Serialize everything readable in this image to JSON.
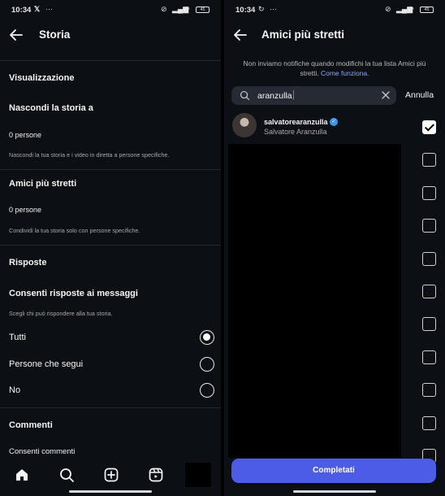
{
  "status_bar": {
    "time": "10:34",
    "battery": "45"
  },
  "left": {
    "title": "Storia",
    "visualization_label": "Visualizzazione",
    "hide_story": {
      "title": "Nascondi la storia a",
      "value": "0 persone",
      "description": "Nascondi la tua storia e i video in diretta a persone specifiche."
    },
    "close_friends": {
      "title": "Amici più stretti",
      "value": "0 persone",
      "description": "Condividi la tua storia solo con persone specifiche."
    },
    "replies_label": "Risposte",
    "allow_replies": {
      "title": "Consenti risposte ai messaggi",
      "description": "Scegli chi può rispondere alla tua storia.",
      "options": [
        {
          "label": "Tutti",
          "selected": true
        },
        {
          "label": "Persone che segui",
          "selected": false
        },
        {
          "label": "No",
          "selected": false
        }
      ]
    },
    "comments_label": "Commenti",
    "allow_comments": "Consenti commenti",
    "nav_icons": [
      "home-icon",
      "search-icon",
      "create-icon",
      "reels-icon",
      "profile-icon"
    ]
  },
  "right": {
    "title": "Amici più stretti",
    "notice": "Non inviamo notifiche quando modifichi la tua lista Amici più stretti.",
    "notice_link": "Come funziona.",
    "search_value": "aranzulla",
    "cancel_label": "Annulla",
    "result": {
      "username": "salvatorearanzulla",
      "verified": true,
      "fullname": "Salvatore Aranzulla",
      "checked": true
    },
    "other_checked": [
      false,
      false,
      false,
      false,
      false,
      false,
      false,
      false,
      false,
      false
    ],
    "done_label": "Completati"
  }
}
